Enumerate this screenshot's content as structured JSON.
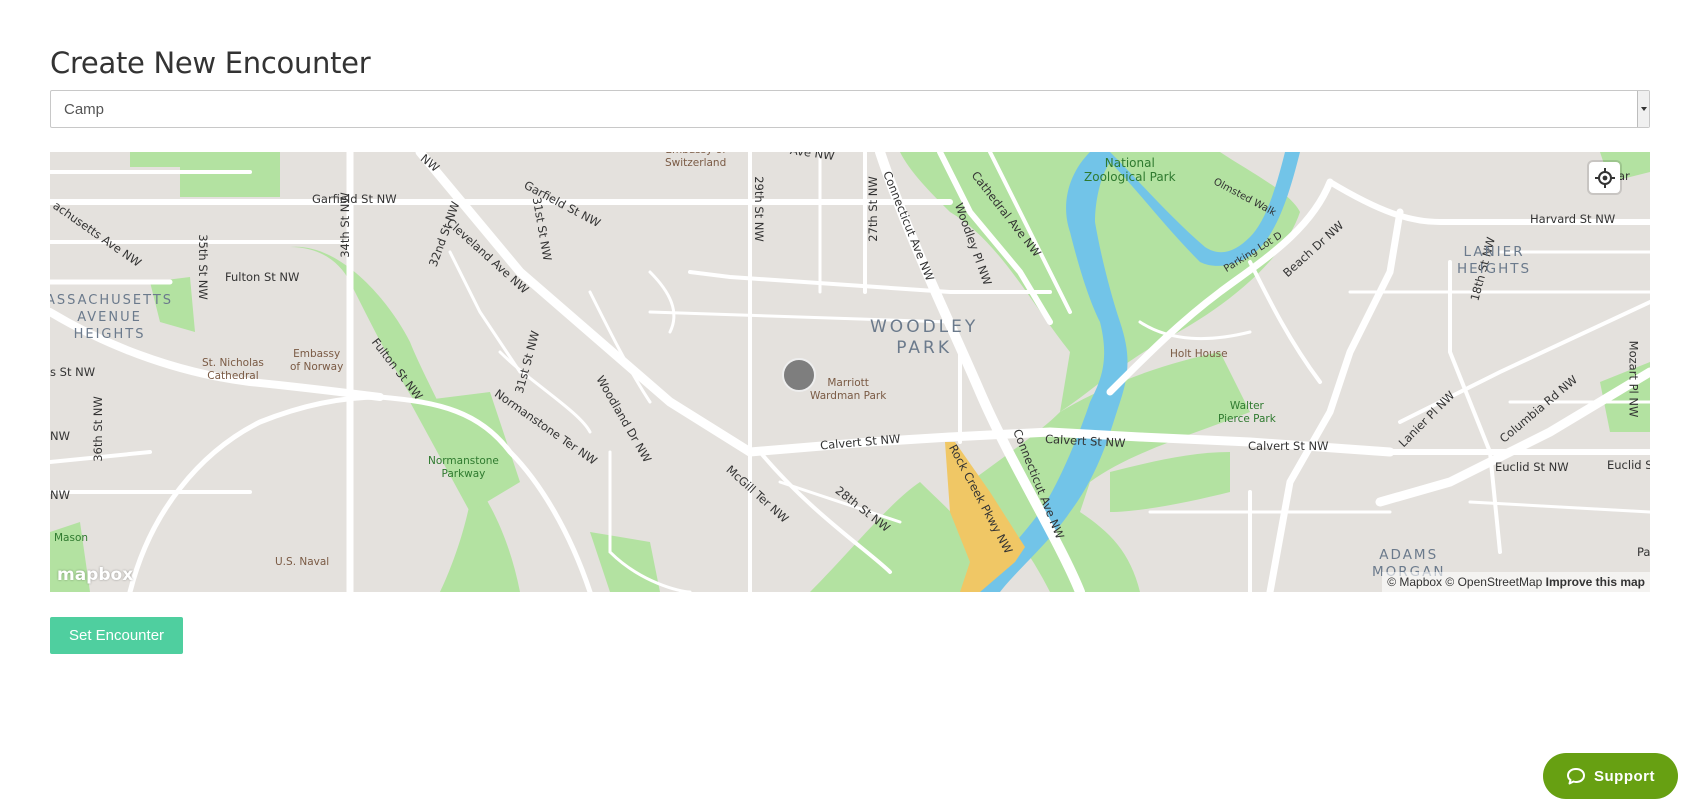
{
  "page": {
    "title": "Create New Encounter"
  },
  "encounter_type": {
    "selected": "Camp"
  },
  "map": {
    "streets": [
      "Garfield St NW",
      "Garfield St NW",
      "Cleveland Ave NW",
      "Connecticut Ave NW",
      "Cathedral Ave NW",
      "Woodley Pl NW",
      "Beach Dr NW",
      "Harvard St NW",
      "Fulton St NW",
      "34th St NW",
      "35th St NW",
      "32nd St NW",
      "31st St NW",
      "29th St NW",
      "27th St NW",
      "Fulton St NW",
      "Normanstone Ter NW",
      "Woodland Dr NW",
      "Calvert St NW",
      "Calvert St NW",
      "Calvert St NW",
      "McGill Ter NW",
      "28th St NW",
      "Rock Creek Pkwy NW",
      "Connecticut Ave NW",
      "Columbia Rd NW",
      "Lanier Pl NW",
      "Euclid St NW",
      "Euclid S",
      "18th St NW",
      "Mozart Pl NW",
      "36th St NW",
      "Hobar",
      "Olmsted Walk",
      "Parking Lot D",
      "31st St NW",
      "s St NW",
      "NW",
      "NW",
      "Ave NW",
      "achusetts Ave NW",
      "NW",
      "Pa"
    ],
    "pois": {
      "embassy_switzerland": "Embassy of\nSwitzerland",
      "zoo": "National\nZoological Park",
      "embassy_norway": "Embassy\nof Norway",
      "st_nicholas": "St. Nicholas\nCathedral",
      "marriott": "Marriott\nWardman Park",
      "holt_house": "Holt House",
      "walter_pierce": "Walter\nPierce Park",
      "normanstone": "Normanstone\nParkway",
      "us_naval": "U.S. Naval",
      "mason": "Mason"
    },
    "neighborhoods": {
      "woodley_park": "WOODLEY\nPARK",
      "lanier_heights": "LANIER\nHEIGHTS",
      "mass_ave_heights": "ASSACHUSETTS\nAVENUE\nHEIGHTS",
      "adams_morgan": "ADAMS\nMORGAN"
    },
    "logo": "mapbox",
    "attribution": {
      "mapbox": "© Mapbox",
      "osm": "© OpenStreetMap",
      "improve": "Improve this map"
    },
    "colors": {
      "park": "#b3e2a1",
      "water": "#72c4e8",
      "road": "#ffffff",
      "land": "#e4e1dd",
      "highway": "#f0c765"
    }
  },
  "actions": {
    "set_label": "Set Encounter"
  },
  "support": {
    "label": "Support"
  },
  "colors": {
    "primary_button": "#4fcf9f",
    "support_button": "#67a012"
  }
}
